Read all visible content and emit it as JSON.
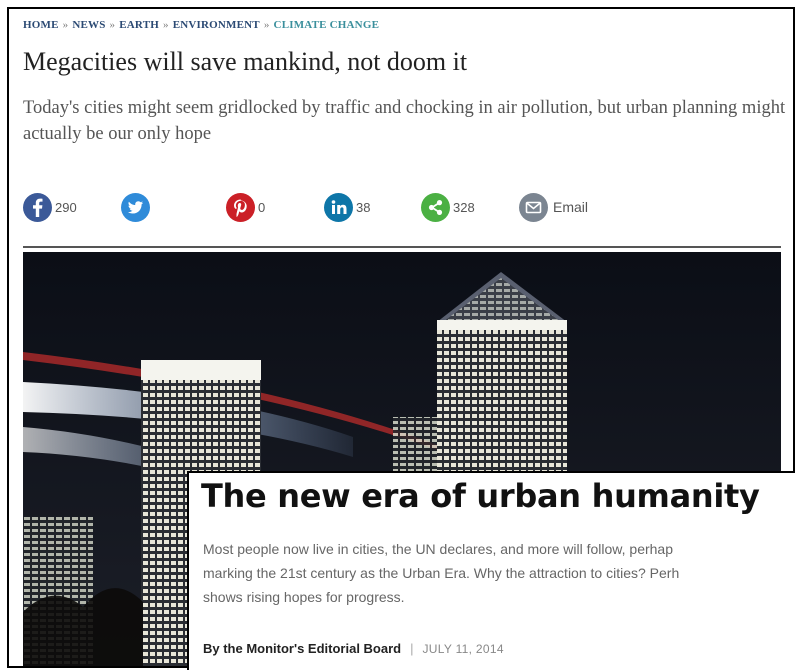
{
  "article_back": {
    "breadcrumb": [
      {
        "label": "HOME"
      },
      {
        "label": "NEWS"
      },
      {
        "label": "EARTH"
      },
      {
        "label": "ENVIRONMENT"
      },
      {
        "label": "CLIMATE CHANGE"
      }
    ],
    "breadcrumb_separator": "»",
    "headline": "Megacities will save mankind, not doom it",
    "standfirst": "Today's cities might seem gridlocked by traffic and chocking in air pollution, but urban planning might actually be our only hope",
    "share": {
      "facebook": {
        "icon": "facebook-icon",
        "color": "#3b5998",
        "count": "290"
      },
      "twitter": {
        "icon": "twitter-icon",
        "color": "#2f8bd9",
        "count": ""
      },
      "pinterest": {
        "icon": "pinterest-icon",
        "color": "#cb2027",
        "count": "0"
      },
      "linkedin": {
        "icon": "linkedin-icon",
        "color": "#0e76a8",
        "count": "38"
      },
      "share": {
        "icon": "share-icon",
        "color": "#4bb043",
        "count": "328"
      },
      "email": {
        "icon": "email-icon",
        "color": "#7b8591",
        "label": "Email"
      }
    }
  },
  "article_front": {
    "title": "The new era of urban humanity",
    "summary_lines": [
      "Most people now live in cities, the UN declares, and more will follow, perhap",
      "marking the 21st century as the Urban Era. Why the attraction to cities? Perh",
      "shows rising hopes for progress."
    ],
    "author": "By the Monitor's Editorial Board",
    "divider": "|",
    "date": "JULY 11, 2014",
    "accent_color": "#1d8fb0"
  }
}
